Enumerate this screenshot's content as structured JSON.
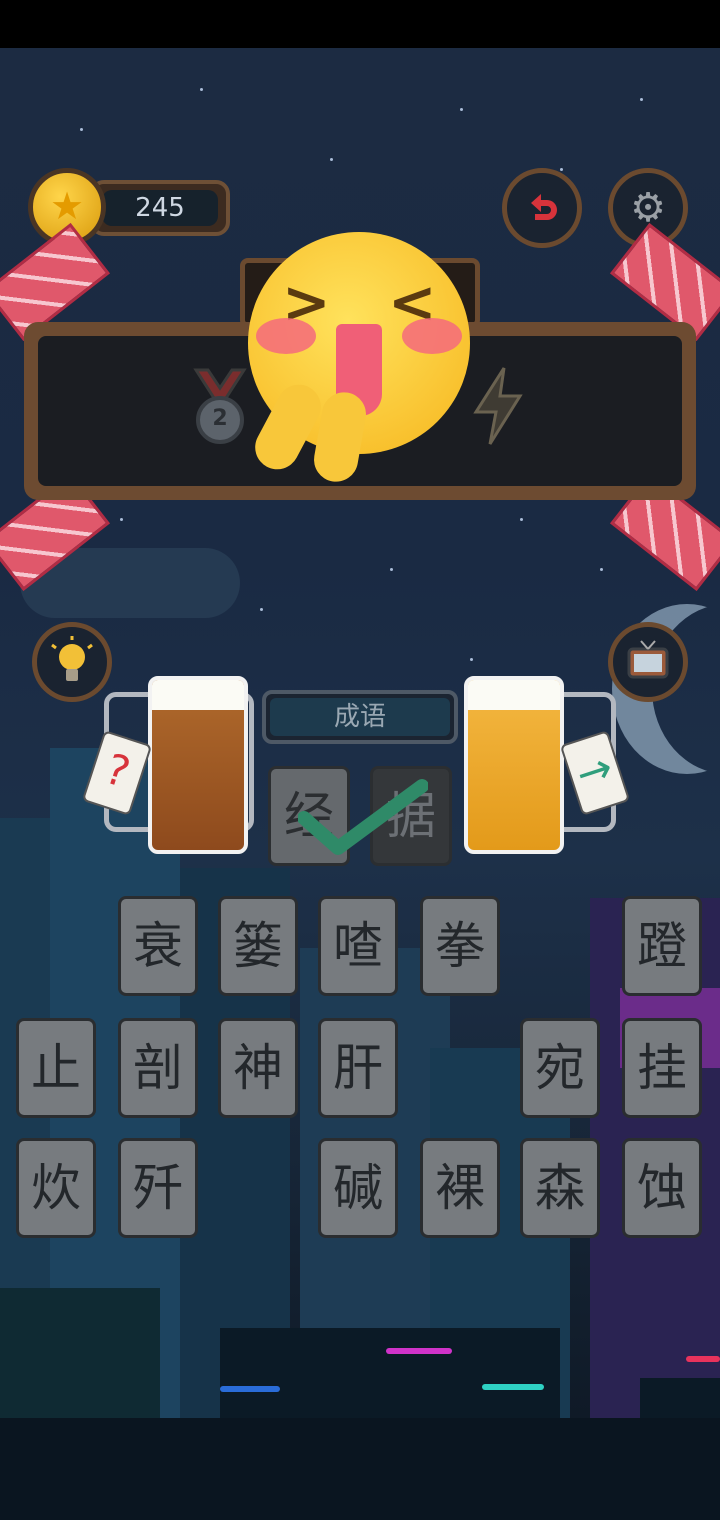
{
  "hud": {
    "coins": "245",
    "coin_icon": "star-coin-icon",
    "undo_icon": "undo-arrow-icon",
    "settings_icon": "gear-icon"
  },
  "panel": {
    "medal_number": "2",
    "medal_icon": "medal-icon",
    "bolt_icon": "lightning-icon"
  },
  "tools": {
    "hint_icon": "lightbulb-icon",
    "tv_icon": "tv-icon"
  },
  "puzzle": {
    "category": "成语",
    "answer": [
      "经",
      "据"
    ],
    "prev_tag": "?",
    "next_tag": "→",
    "check_icon": "checkmark-icon"
  },
  "grid": {
    "row1": [
      "衰",
      "篓",
      "喳",
      "拳",
      "蹬"
    ],
    "row2": [
      "止",
      "剖",
      "神",
      "肝",
      "宛",
      "挂"
    ],
    "row3": [
      "炊",
      "歼",
      "碱",
      "裸",
      "森",
      "蚀"
    ]
  },
  "colors": {
    "accent_red": "#d7333b",
    "emoji_yellow": "#f6b51d",
    "checkmark_green": "#2f8a68",
    "tile_grey": "#777b7f"
  }
}
